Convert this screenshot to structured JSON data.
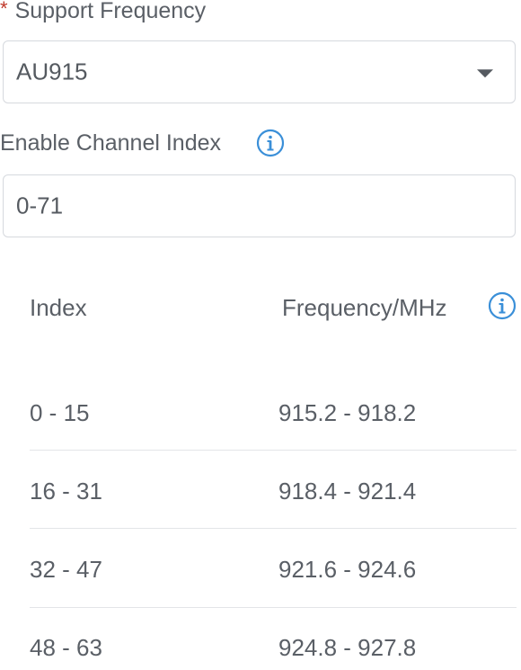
{
  "support_frequency": {
    "required_marker": "*",
    "label": "Support Frequency",
    "selected_value": "AU915",
    "dropdown_icon": "chevron-down-icon"
  },
  "channel_index": {
    "label": "Enable Channel Index",
    "info_icon": "info-icon",
    "value": "0-71"
  },
  "table": {
    "headers": {
      "index": "Index",
      "frequency": "Frequency/MHz",
      "info_icon": "info-icon"
    },
    "rows": [
      {
        "index": "0 - 15",
        "frequency": "915.2 - 918.2"
      },
      {
        "index": "16 - 31",
        "frequency": "918.4 - 921.4"
      },
      {
        "index": "32 - 47",
        "frequency": "921.6 - 924.6"
      },
      {
        "index": "48 - 63",
        "frequency": "924.8 - 927.8"
      }
    ]
  },
  "colors": {
    "accent": "#3a8fd8",
    "required": "#c0392b",
    "text": "#5a5f66",
    "border": "#d6d9de"
  }
}
